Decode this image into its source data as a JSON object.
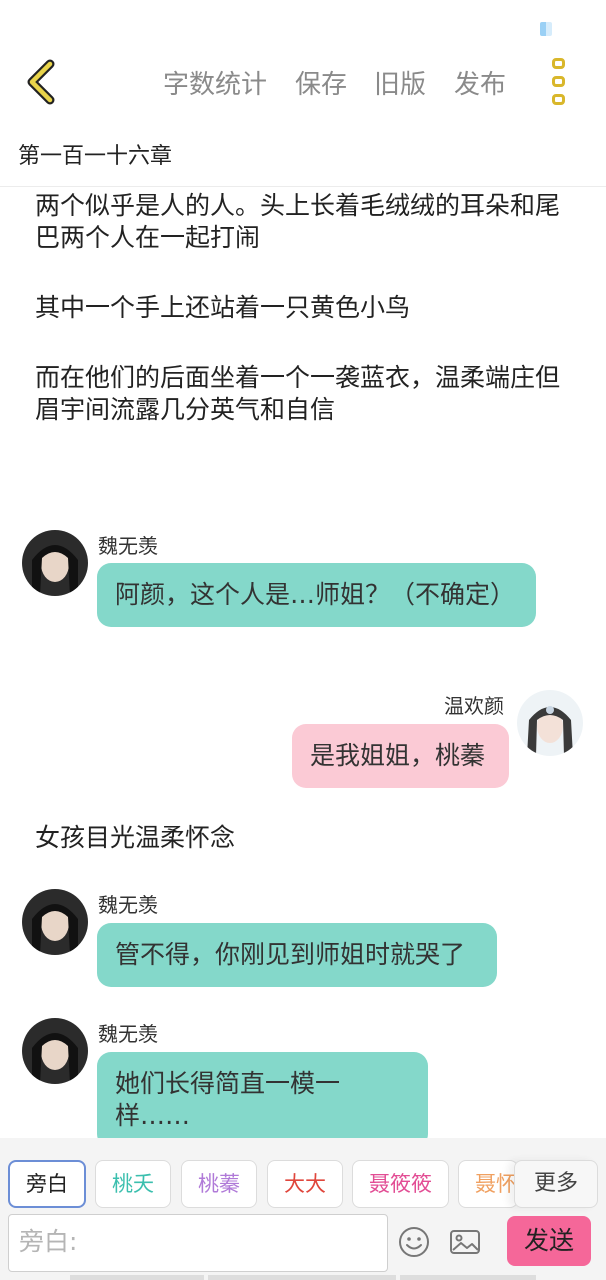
{
  "colors": {
    "accent_yellow": "#d9b72b",
    "bubble_teal": "#84d8ca",
    "bubble_pink": "#fbcad5",
    "send_pink": "#f56799"
  },
  "toolbar": {
    "back_icon": "chevron-left-icon",
    "word_count": "字数统计",
    "save": "保存",
    "old_version": "旧版",
    "publish": "发布",
    "more_icon": "vertical-dots-icon"
  },
  "chapter_title": "第一百一十六章",
  "narration": [
    "两个似乎是人的人。头上长着毛绒绒的耳朵和尾巴两个人在一起打闹",
    "其中一个手上还站着一只黄色小鸟",
    "而在他们的后面坐着一个一袭蓝衣，温柔端庄但眉宇间流露几分英气和自信",
    "女孩目光温柔怀念"
  ],
  "messages": [
    {
      "sender": "魏无羡",
      "text": "阿颜，这个人是…师姐？（不确定）"
    },
    {
      "sender": "温欢颜",
      "text": "是我姐姐，桃蓁"
    },
    {
      "sender": "魏无羡",
      "text": "管不得，你刚见到师姐时就哭了"
    },
    {
      "sender": "魏无羡",
      "text": "她们长得简直一模一样……"
    }
  ],
  "roles": [
    {
      "label": "旁白",
      "color": "#555555"
    },
    {
      "label": "桃夭",
      "color": "#3bbfae"
    },
    {
      "label": "桃蓁",
      "color": "#b07ad8"
    },
    {
      "label": "大大",
      "color": "#e0463c"
    },
    {
      "label": "聂筱筱",
      "color": "#e24d94"
    },
    {
      "label": "聂怀",
      "color": "#f0a060"
    }
  ],
  "more_roles": "更多",
  "input": {
    "placeholder": "旁白:"
  },
  "icons": {
    "emoji": "smiley-icon",
    "image": "image-icon"
  },
  "send_label": "发送"
}
